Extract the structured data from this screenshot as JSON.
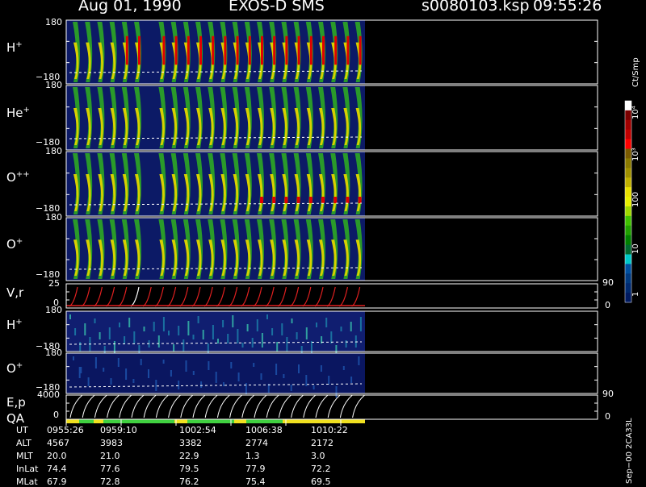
{
  "header": {
    "date": "Aug 01, 1990",
    "instrument": "EXOS-D SMS",
    "file": "s0080103.ksp",
    "time": "09:55:26"
  },
  "panels": [
    {
      "label": "H",
      "sup": "+",
      "top_tick": "180",
      "bottom_tick": "−180"
    },
    {
      "label": "He",
      "sup": "+",
      "top_tick": "180",
      "bottom_tick": "−180"
    },
    {
      "label": "O",
      "sup": "++",
      "top_tick": "180",
      "bottom_tick": "−180"
    },
    {
      "label": "O",
      "sup": "+",
      "top_tick": "180",
      "bottom_tick": "−180"
    },
    {
      "label": "V,r",
      "sup": "",
      "top_tick": "25",
      "bottom_tick": "0",
      "right_top": "90",
      "right_bottom": "0"
    },
    {
      "label": "H",
      "sup": "+",
      "top_tick": "180",
      "bottom_tick": "−180"
    },
    {
      "label": "O",
      "sup": "+",
      "top_tick": "180",
      "bottom_tick": "−180"
    },
    {
      "label": "E,p",
      "sup": "",
      "label2": "QA",
      "top_tick": "4000",
      "bottom_tick": "0",
      "right_top": "90",
      "right_bottom": "0"
    }
  ],
  "colorbar": {
    "title": "Ct/Smp",
    "ticks": [
      "10⁴",
      "10³",
      "100",
      "10",
      "1"
    ],
    "colors": [
      "#ffffff",
      "#7a0000",
      "#a00000",
      "#c00000",
      "#ff0000",
      "#7a5a00",
      "#8a7a00",
      "#a09000",
      "#c0b000",
      "#e8e000",
      "#e8f000",
      "#a0d800",
      "#40c000",
      "#20a000",
      "#008000",
      "#006a30",
      "#00c8c8",
      "#0050a0",
      "#003a80",
      "#002a70",
      "#001a60"
    ]
  },
  "orbit": {
    "rows": [
      {
        "name": "UT",
        "values": [
          "0955:26",
          "0959:10",
          "1002:54",
          "1006:38",
          "1010:22"
        ]
      },
      {
        "name": "ALT",
        "values": [
          "4567",
          "3983",
          "3382",
          "2774",
          "2172"
        ]
      },
      {
        "name": "MLT",
        "values": [
          "20.0",
          "21.0",
          "22.9",
          "1.3",
          "3.0"
        ]
      },
      {
        "name": "InLat",
        "values": [
          "74.4",
          "77.6",
          "79.5",
          "77.9",
          "72.2"
        ]
      },
      {
        "name": "MLat",
        "values": [
          "67.9",
          "72.8",
          "76.2",
          "75.4",
          "69.5"
        ]
      }
    ]
  },
  "footer": {
    "vertical": "Sep−00  2CA33L"
  },
  "theme": {
    "frame": "#ffffff",
    "background": "#000000",
    "plot_fill": "#0c1a66",
    "qa_green": "#40d040",
    "qa_yellow": "#f0e020"
  }
}
